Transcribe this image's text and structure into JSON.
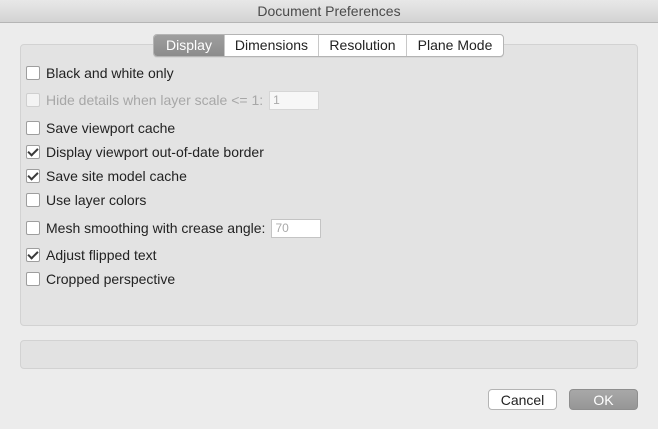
{
  "window": {
    "title": "Document Preferences"
  },
  "tabs": [
    {
      "label": "Display",
      "active": true
    },
    {
      "label": "Dimensions",
      "active": false
    },
    {
      "label": "Resolution",
      "active": false
    },
    {
      "label": "Plane Mode",
      "active": false
    }
  ],
  "options": [
    {
      "label": "Black and white only",
      "checked": false,
      "enabled": true
    },
    {
      "label": "Hide details when layer scale <= 1:",
      "checked": false,
      "enabled": false,
      "field_value": "1"
    },
    {
      "label": "Save viewport cache",
      "checked": false,
      "enabled": true
    },
    {
      "label": "Display viewport out-of-date border",
      "checked": true,
      "enabled": true
    },
    {
      "label": "Save site model cache",
      "checked": true,
      "enabled": true
    },
    {
      "label": "Use layer colors",
      "checked": false,
      "enabled": true
    },
    {
      "label": "Mesh smoothing with crease angle:",
      "checked": false,
      "enabled": true,
      "field_value": "70"
    },
    {
      "label": "Adjust flipped text",
      "checked": true,
      "enabled": true
    },
    {
      "label": "Cropped perspective",
      "checked": false,
      "enabled": true
    }
  ],
  "buttons": {
    "cancel_label": "Cancel",
    "ok_label": "OK"
  },
  "colors": {
    "window_bg": "#ececec",
    "active_tab": "#969696",
    "default_button": "#9e9e9e"
  }
}
